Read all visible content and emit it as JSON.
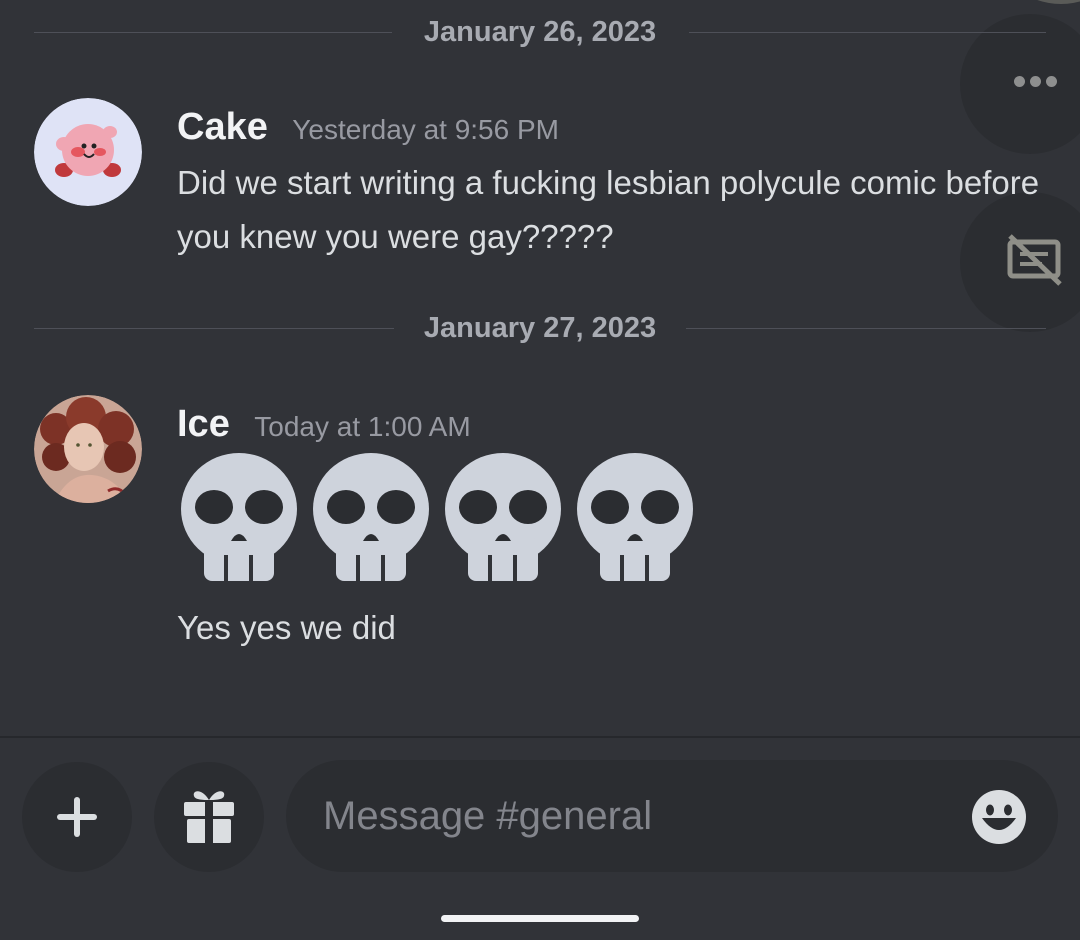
{
  "separators": [
    {
      "date": "January 26, 2023"
    },
    {
      "date": "January 27, 2023"
    }
  ],
  "messages": [
    {
      "username": "Cake",
      "timestamp": "Yesterday at 9:56 PM",
      "text": "Did we start writing a fucking lesbian polycule comic before you knew you were gay?????",
      "avatar": "kirby-avatar"
    },
    {
      "username": "Ice",
      "timestamp": "Today at 1:00 AM",
      "emoji": [
        "skull",
        "skull",
        "skull",
        "skull"
      ],
      "text": "Yes yes we did",
      "avatar": "portrait-avatar"
    }
  ],
  "side_actions": {
    "icons": [
      "more-icon",
      "thread-off-icon"
    ]
  },
  "composer": {
    "placeholder": "Message #general",
    "icons": [
      "plus-icon",
      "gift-icon",
      "emoji-smile-icon"
    ]
  },
  "colors": {
    "background": "#313338",
    "button": "#2b2d31",
    "username": "#f2f3f5",
    "body_text": "#dbdee1",
    "muted": "#989aa2"
  }
}
